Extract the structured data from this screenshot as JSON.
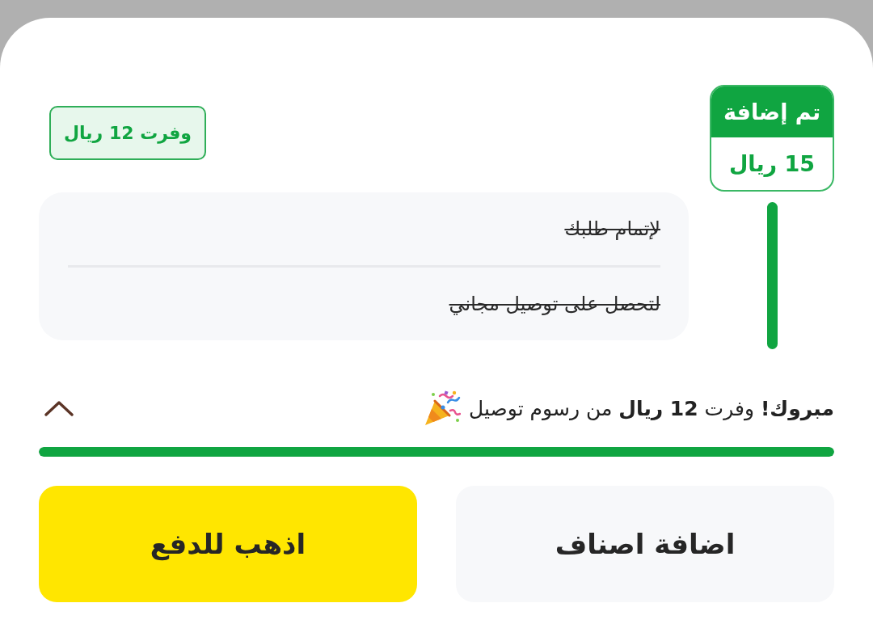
{
  "milestone": {
    "status": "تم إضافة",
    "amount": "15 ريال",
    "reached": true
  },
  "savings_badge": {
    "text": "وفرت 12 ريال"
  },
  "conditions": [
    {
      "text": "لإتمام طلبك",
      "done": true
    },
    {
      "text": "لتحصل على توصيل مجاني",
      "done": true
    }
  ],
  "message": {
    "text": "**مبروك!** وفرت **12 ريال** من رسوم توصيل",
    "expanded": true
  },
  "progress": {
    "level": 1
  },
  "buttons": [
    {
      "label": "اضافة اصناف",
      "kind": "secondary"
    },
    {
      "label": "اذهب للدفع",
      "kind": "primary"
    }
  ]
}
